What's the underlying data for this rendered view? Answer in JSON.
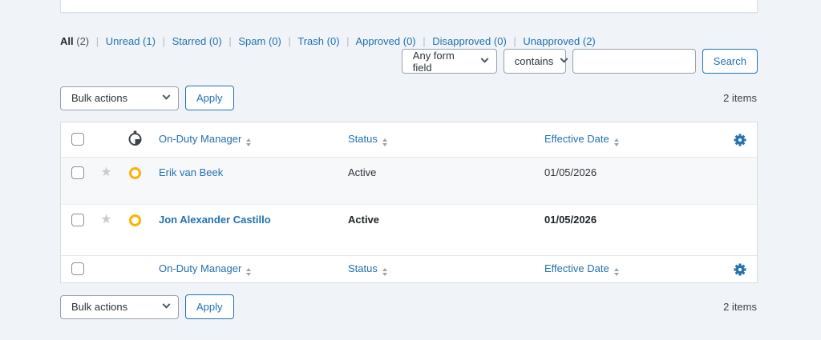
{
  "filters": {
    "separator": "|",
    "items": [
      {
        "label": "All",
        "count": "(2)",
        "active": true
      },
      {
        "label": "Unread",
        "count": "(1)",
        "active": false
      },
      {
        "label": "Starred",
        "count": "(0)",
        "active": false
      },
      {
        "label": "Spam",
        "count": "(0)",
        "active": false
      },
      {
        "label": "Trash",
        "count": "(0)",
        "active": false
      },
      {
        "label": "Approved",
        "count": "(0)",
        "active": false
      },
      {
        "label": "Disapproved",
        "count": "(0)",
        "active": false
      },
      {
        "label": "Unapproved",
        "count": "(2)",
        "active": false
      }
    ]
  },
  "search": {
    "field_select_value": "Any form field",
    "operator_select_value": "contains",
    "input_value": "",
    "button_label": "Search"
  },
  "bulk_actions": {
    "top_select_value": "Bulk actions",
    "top_apply_label": "Apply",
    "top_items_count": "2 items",
    "bottom_select_value": "Bulk actions",
    "bottom_apply_label": "Apply",
    "bottom_items_count": "2 items"
  },
  "table": {
    "columns": {
      "name_label": "On-Duty Manager",
      "status_label": "Status",
      "date_label": "Effective Date"
    },
    "icons": {
      "approval_column_icon": "timer-icon",
      "settings_icon": "gear-icon",
      "star_icon": "star-icon",
      "approval_status_icon": "orange-ring-unapproved"
    },
    "rows": [
      {
        "name": "Erik van Beek",
        "status": "Active",
        "date": "01/05/2026",
        "unread_bold": false
      },
      {
        "name": "Jon Alexander Castillo",
        "status": "Active",
        "date": "01/05/2026",
        "unread_bold": true
      }
    ]
  },
  "colors": {
    "link_blue": "#2271b1",
    "accent_orange": "#ffb000",
    "page_background": "#f0f4f9",
    "row_alt_background": "#f6f8fa"
  }
}
